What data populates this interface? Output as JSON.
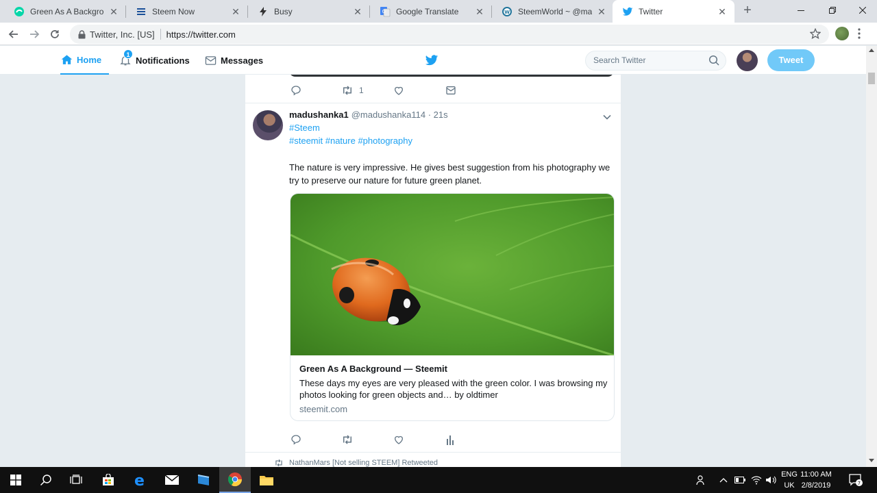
{
  "browser": {
    "tabs": [
      {
        "title": "Green As A Background",
        "favicon": "steemit-icon",
        "active": false
      },
      {
        "title": "Steem Now",
        "favicon": "list-icon",
        "active": false
      },
      {
        "title": "Busy",
        "favicon": "bolt-icon",
        "active": false
      },
      {
        "title": "Google Translate",
        "favicon": "translate-icon",
        "active": false
      },
      {
        "title": "SteemWorld ~ @madu",
        "favicon": "wordpress-icon",
        "active": false
      },
      {
        "title": "Twitter",
        "favicon": "twitter-icon",
        "active": true
      }
    ],
    "site_identity": "Twitter, Inc. [US]",
    "url": "https://twitter.com"
  },
  "header": {
    "nav": [
      {
        "label": "Home",
        "icon": "home-icon",
        "active": true
      },
      {
        "label": "Notifications",
        "icon": "bell-icon",
        "badge": "1"
      },
      {
        "label": "Messages",
        "icon": "envelope-icon"
      }
    ],
    "search_placeholder": "Search Twitter",
    "tweet_button": "Tweet"
  },
  "previous_tweet": {
    "retweet_count": "1"
  },
  "tweet": {
    "name": "madushanka1",
    "handle": "@madushanka114",
    "time": "· 21s",
    "hashtag_line_1": "#Steem",
    "hashtag_line_2": "#steemit #nature #photography",
    "text": "The nature is very impressive. He gives best suggestion from his photography we try to preserve our nature for future green planet.",
    "card": {
      "image": "ladybug on green leaf",
      "title": "Green As A Background — Steemit",
      "description": "These days my eyes are very pleased with the green color. I was browsing my photos looking for green objects and… by oldtimer",
      "domain": "steemit.com"
    }
  },
  "next_tweet": {
    "context": "NathanMars [Not selling STEEM] Retweeted"
  },
  "taskbar": {
    "language_line_1": "ENG",
    "language_line_2": "UK",
    "time": "11:00 AM",
    "date": "2/8/2019",
    "notification_count": "7"
  },
  "colors": {
    "twitter_blue": "#1da1f2",
    "tweet_button": "#71c9f8",
    "page_background": "#e6ecf0",
    "taskbar": "#101010"
  }
}
